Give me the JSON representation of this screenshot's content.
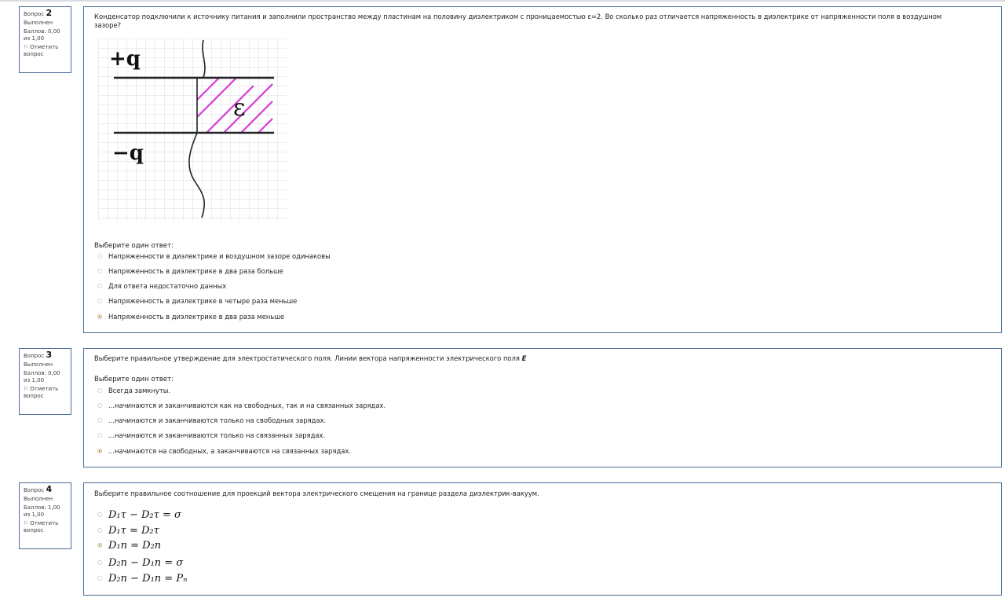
{
  "questions": [
    {
      "info": {
        "label": "Вопрос",
        "number": "2",
        "status": "Выполнен",
        "score_line1": "Баллов: 0,00",
        "score_line2": "из 1,00",
        "flag_line1": "Отметить",
        "flag_line2": "вопрос"
      },
      "text_line1": "Конденсатор подключили к источнику питания и заполнили пространство между пластинам на половину диэлектриком с проницаемостью ε=2. Во сколько раз отличается напряженность в диэлектрике от напряженности поля в воздушном",
      "text_line2": "зазоре?",
      "figure_labels": {
        "plus": "+q",
        "minus": "−q",
        "eps": "ε"
      },
      "prompt": "Выберите один ответ:",
      "options": [
        {
          "label": "Напряженности в диэлектрике и воздушном зазоре одинаковы",
          "checked": false
        },
        {
          "label": "Напряженность в диэлектрике в два раза больше",
          "checked": false
        },
        {
          "label": "Для ответа недостаточно данных",
          "checked": false
        },
        {
          "label": "Напряженность в диэлектрике в четыре раза меньше",
          "checked": false
        },
        {
          "label": "Напряженность в диэлектрике в два раза меньше",
          "checked": true
        }
      ]
    },
    {
      "info": {
        "label": "Вопрос",
        "number": "3",
        "status": "Выполнен",
        "score_line1": "Баллов: 0,00",
        "score_line2": "из 1,00",
        "flag_line1": "Отметить",
        "flag_line2": "вопрос"
      },
      "text": "Выберите правильное утверждение для электростатического поля. Линии вектора напряженности электрического поля",
      "text_bold": "E",
      "prompt": "Выберите один ответ:",
      "options": [
        {
          "label": "Всегда замкнуты.",
          "checked": false
        },
        {
          "label": "...начинаются и заканчиваются как на свободных, так и на связанных зарядах.",
          "checked": false
        },
        {
          "label": "...начинаются и заканчиваются только на свободных зарядах.",
          "checked": false
        },
        {
          "label": "...начинаются и заканчиваются только на связанных зарядах.",
          "checked": false
        },
        {
          "label": "...начинаются на свободных, а заканчиваются на связанных зарядах.",
          "checked": true
        }
      ]
    },
    {
      "info": {
        "label": "Вопрос",
        "number": "4",
        "status": "Выполнен",
        "score_line1": "Баллов: 1,00",
        "score_line2": "из 1,00",
        "flag_line1": "Отметить",
        "flag_line2": "вопрос"
      },
      "text": "Выберите правильное соотношение для проекций вектора электрического смещения на границе раздела диэлектрик-вакуум.",
      "options": [
        {
          "label": "D₁τ − D₂τ = σ",
          "checked": false
        },
        {
          "label": "D₁τ = D₂τ",
          "checked": false
        },
        {
          "label": "D₁n = D₂n",
          "checked": true
        },
        {
          "label": "D₂n − D₁n = σ",
          "checked": false
        },
        {
          "label": "D₂n − D₁n = Pₙ",
          "checked": false
        }
      ]
    }
  ]
}
